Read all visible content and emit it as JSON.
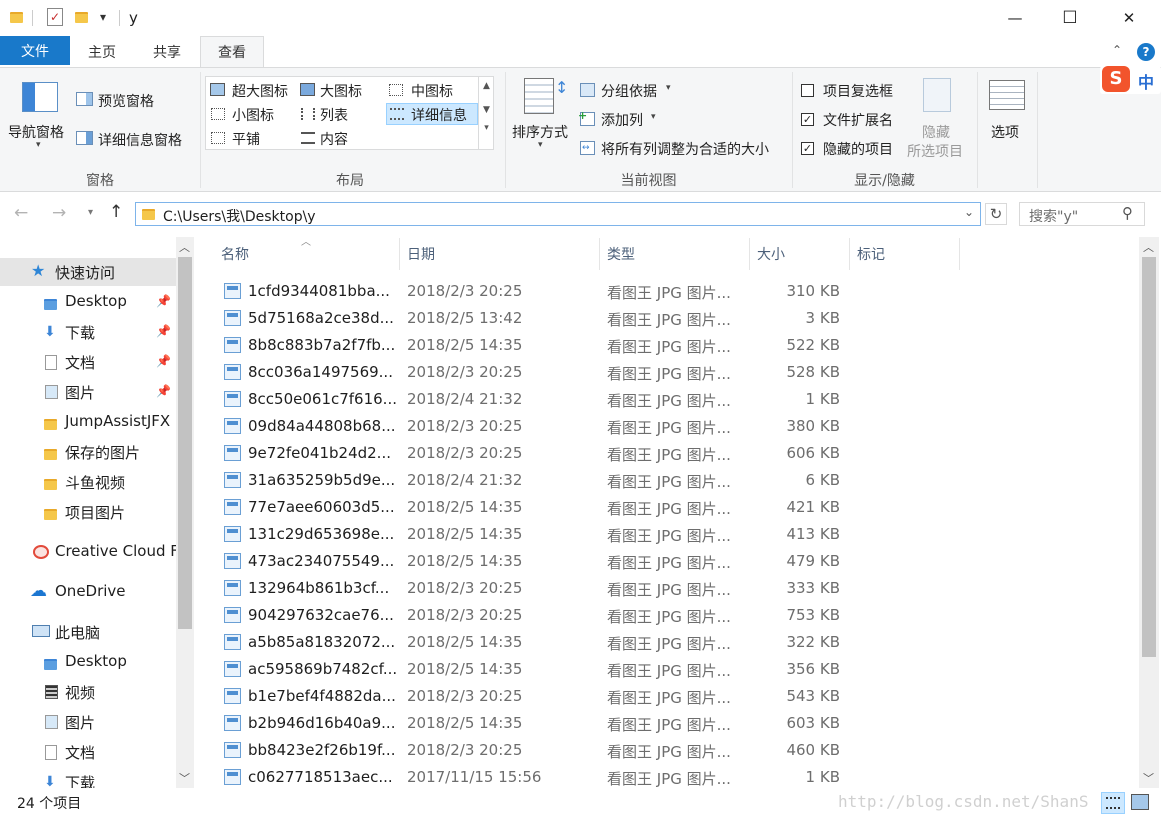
{
  "window": {
    "title": "y",
    "buttons": {
      "minimize": "—",
      "maximize": "☐",
      "close": "✕"
    }
  },
  "quickaccess_toolbar": {
    "dropdown": "▾"
  },
  "tabs": {
    "file": "文件",
    "home": "主页",
    "share": "共享",
    "view": "查看"
  },
  "ribbon": {
    "pane_group": {
      "nav_pane": "导航窗格",
      "preview_pane": "预览窗格",
      "details_pane": "详细信息窗格",
      "label": "窗格"
    },
    "layout_group": {
      "items": [
        "超大图标",
        "大图标",
        "中图标",
        "小图标",
        "列表",
        "详细信息",
        "平铺",
        "内容"
      ],
      "label": "布局"
    },
    "current_view_group": {
      "sort_by": "排序方式",
      "group_by": "分组依据",
      "add_columns": "添加列",
      "fit_columns": "将所有列调整为合适的大小",
      "label": "当前视图"
    },
    "show_hide_group": {
      "item_checkboxes": "项目复选框",
      "item_checkboxes_checked": false,
      "file_extensions": "文件扩展名",
      "file_extensions_checked": true,
      "hidden_items": "隐藏的项目",
      "hidden_items_checked": true,
      "hide_selected_line1": "隐藏",
      "hide_selected_line2": "所选项目",
      "label": "显示/隐藏"
    },
    "options": "选项",
    "ime_badge": "中"
  },
  "address": {
    "path": "C:\\Users\\我\\Desktop\\y",
    "search_placeholder": "搜索\"y\""
  },
  "nav": {
    "quick_access": "快速访问",
    "items": [
      {
        "label": "Desktop",
        "pinned": true
      },
      {
        "label": "下载",
        "pinned": true
      },
      {
        "label": "文档",
        "pinned": true
      },
      {
        "label": "图片",
        "pinned": true
      },
      {
        "label": "JumpAssistJFX",
        "pinned": false
      },
      {
        "label": "保存的图片",
        "pinned": false
      },
      {
        "label": "斗鱼视频",
        "pinned": false
      },
      {
        "label": "项目图片",
        "pinned": false
      }
    ],
    "creative_cloud": "Creative Cloud F",
    "onedrive": "OneDrive",
    "this_pc": "此电脑",
    "pc_items": [
      "Desktop",
      "视频",
      "图片",
      "文档",
      "下载"
    ]
  },
  "columns": {
    "name": "名称",
    "date": "日期",
    "type": "类型",
    "size": "大小",
    "tags": "标记"
  },
  "files": [
    {
      "name": "1cfd9344081bba...",
      "date": "2018/2/3 20:25",
      "type": "看图王 JPG 图片...",
      "size": "310 KB"
    },
    {
      "name": "5d75168a2ce38d...",
      "date": "2018/2/5 13:42",
      "type": "看图王 JPG 图片...",
      "size": "3 KB"
    },
    {
      "name": "8b8c883b7a2f7fb...",
      "date": "2018/2/5 14:35",
      "type": "看图王 JPG 图片...",
      "size": "522 KB"
    },
    {
      "name": "8cc036a1497569...",
      "date": "2018/2/3 20:25",
      "type": "看图王 JPG 图片...",
      "size": "528 KB"
    },
    {
      "name": "8cc50e061c7f616...",
      "date": "2018/2/4 21:32",
      "type": "看图王 JPG 图片...",
      "size": "1 KB"
    },
    {
      "name": "09d84a44808b68...",
      "date": "2018/2/3 20:25",
      "type": "看图王 JPG 图片...",
      "size": "380 KB"
    },
    {
      "name": "9e72fe041b24d2...",
      "date": "2018/2/3 20:25",
      "type": "看图王 JPG 图片...",
      "size": "606 KB"
    },
    {
      "name": "31a635259b5d9e...",
      "date": "2018/2/4 21:32",
      "type": "看图王 JPG 图片...",
      "size": "6 KB"
    },
    {
      "name": "77e7aee60603d5...",
      "date": "2018/2/5 14:35",
      "type": "看图王 JPG 图片...",
      "size": "421 KB"
    },
    {
      "name": "131c29d653698e...",
      "date": "2018/2/5 14:35",
      "type": "看图王 JPG 图片...",
      "size": "413 KB"
    },
    {
      "name": "473ac234075549...",
      "date": "2018/2/5 14:35",
      "type": "看图王 JPG 图片...",
      "size": "479 KB"
    },
    {
      "name": "132964b861b3cf...",
      "date": "2018/2/3 20:25",
      "type": "看图王 JPG 图片...",
      "size": "333 KB"
    },
    {
      "name": "904297632cae76...",
      "date": "2018/2/3 20:25",
      "type": "看图王 JPG 图片...",
      "size": "753 KB"
    },
    {
      "name": "a5b85a81832072...",
      "date": "2018/2/5 14:35",
      "type": "看图王 JPG 图片...",
      "size": "322 KB"
    },
    {
      "name": "ac595869b7482cf...",
      "date": "2018/2/5 14:35",
      "type": "看图王 JPG 图片...",
      "size": "356 KB"
    },
    {
      "name": "b1e7bef4f4882da...",
      "date": "2018/2/3 20:25",
      "type": "看图王 JPG 图片...",
      "size": "543 KB"
    },
    {
      "name": "b2b946d16b40a9...",
      "date": "2018/2/5 14:35",
      "type": "看图王 JPG 图片...",
      "size": "603 KB"
    },
    {
      "name": "bb8423e2f26b19f...",
      "date": "2018/2/3 20:25",
      "type": "看图王 JPG 图片...",
      "size": "460 KB"
    },
    {
      "name": "c0627718513aec...",
      "date": "2017/11/15 15:56",
      "type": "看图王 JPG 图片...",
      "size": "1 KB"
    }
  ],
  "status": {
    "count": "24 个项目",
    "watermark": "http://blog.csdn.net/ShanS"
  },
  "colors": {
    "accent": "#1979ca",
    "selected_bg": "#cce8ff",
    "hover_bg": "#e5f3ff"
  }
}
